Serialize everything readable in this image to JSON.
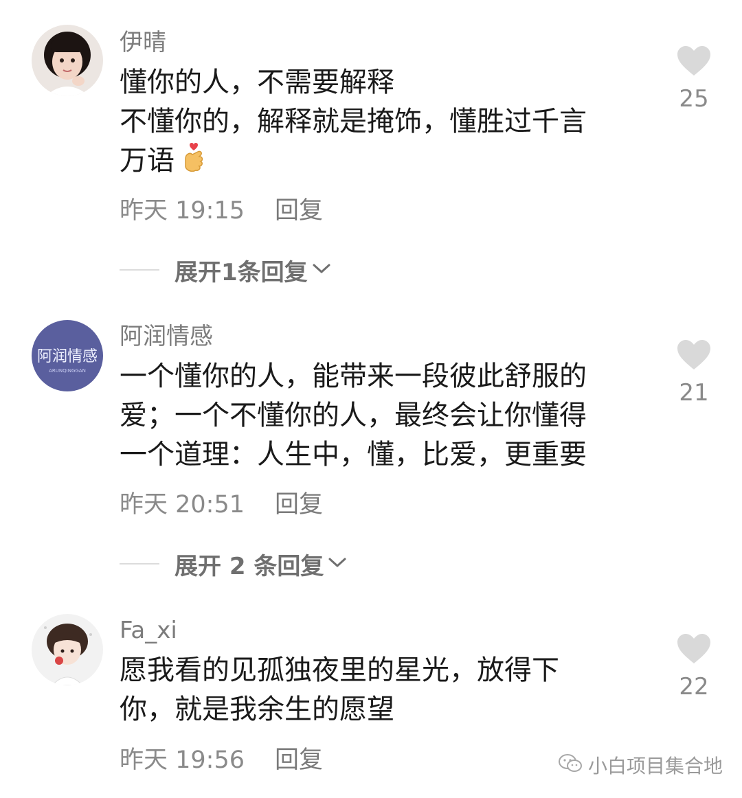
{
  "comments": [
    {
      "username": "伊晴",
      "lines": [
        "懂你的人，不需要解释",
        "不懂你的，解释就是掩饰，懂胜过千言",
        "万语"
      ],
      "emoji_icon": "finger-heart-emoji",
      "time": "昨天 19:15",
      "reply_label": "回复",
      "expand_label": "展开1条回复",
      "likes": "25"
    },
    {
      "username": "阿润情感",
      "avatar_text": "阿润情感",
      "avatar_subtext": "ARUNQINGGAN",
      "lines": [
        "一个懂你的人，能带来一段彼此舒服的",
        "爱；一个不懂你的人，最终会让你懂得",
        "一个道理：人生中，懂，比爱，更重要"
      ],
      "time": "昨天 20:51",
      "reply_label": "回复",
      "expand_label": "展开 2 条回复",
      "likes": "21"
    },
    {
      "username": "Fa_xi",
      "lines": [
        "愿我看的见孤独夜里的星光，放得下",
        "你，就是我余生的愿望"
      ],
      "time": "昨天 19:56",
      "reply_label": "回复",
      "likes": "22"
    }
  ],
  "icons": {
    "like": "heart-icon",
    "expand": "chevron-down-icon",
    "watermark": "wechat-icon"
  },
  "watermark": "小白项目集合地",
  "colors": {
    "username": "#7c7c7c",
    "content": "#1a1a1a",
    "meta": "#8a8a8a",
    "heart": "#d9d9d9",
    "avatar2_bg": "#5a5f9e"
  }
}
